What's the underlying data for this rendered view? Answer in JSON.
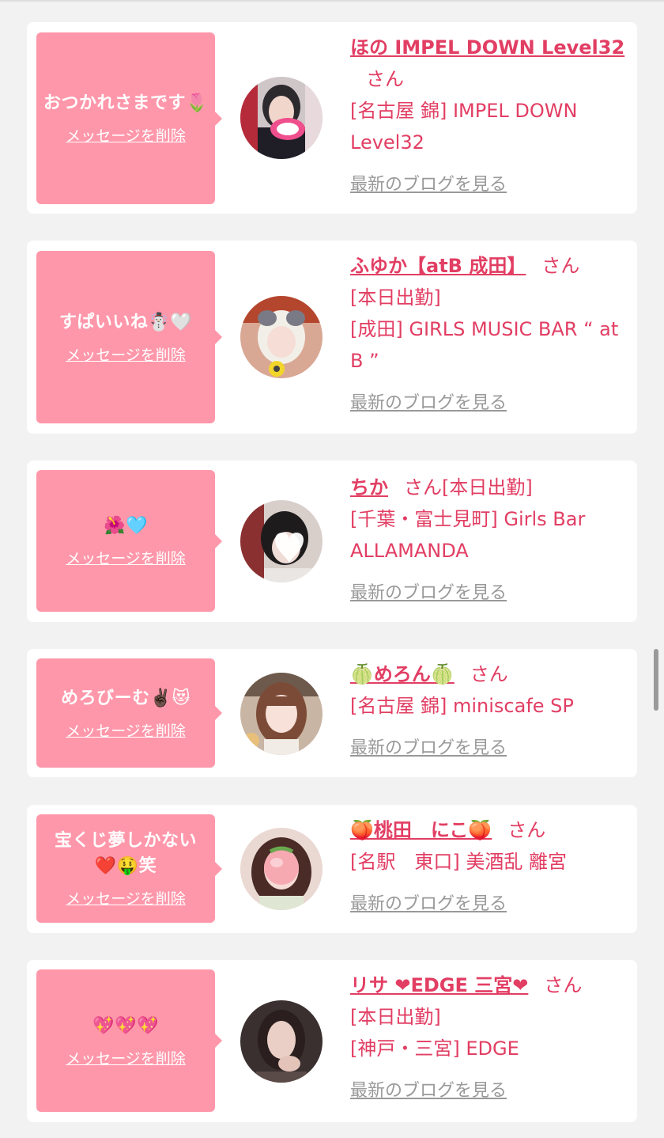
{
  "delete_label": "メッセージを削除",
  "blog_label": "最新のブログを見る",
  "san_label": "さん",
  "colors": {
    "bubble": "#ff97aa",
    "accent": "#e23e63",
    "blog_link": "#999999",
    "background": "#f2f2f2"
  },
  "messages": [
    {
      "message": "おつかれさまです🌷",
      "name": "ほの IMPEL DOWN Level32",
      "detail_lines": [
        "[名古屋 錦] IMPEL DOWN Level32"
      ]
    },
    {
      "message": "すぱいいね☃️🤍",
      "name": "ふゆか【atB 成田】",
      "detail_lines": [
        "[本日出勤]",
        "[成田] GIRLS MUSIC BAR “ at B ”"
      ]
    },
    {
      "message": "🌺🩵",
      "name": "ちか",
      "inline_detail": "[本日出勤]",
      "detail_lines": [
        "[千葉・富士見町] Girls Bar ALLAMANDA"
      ]
    },
    {
      "message": "めろびーむ✌🏿😻",
      "name": "🍈めろん🍈",
      "detail_lines": [
        "[名古屋 錦] miniscafe SP"
      ]
    },
    {
      "message": "宝くじ夢しかない❤️🤑笑",
      "name": "🍑桃田　にこ🍑",
      "detail_lines": [
        "[名駅　東口] 美酒乱 離宮"
      ]
    },
    {
      "message": "💖💖💖",
      "name": "リサ ❤EDGE 三宮❤",
      "detail_lines": [
        "[本日出勤]",
        "[神戸・三宮] EDGE"
      ]
    }
  ]
}
